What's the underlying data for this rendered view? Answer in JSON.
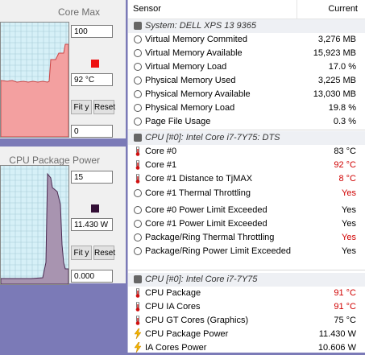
{
  "panel1": {
    "title": "Core Max",
    "max_value": "100",
    "current_value": "92 °C",
    "min_value": "0",
    "color": "#ee1111",
    "fit_label": "Fit y",
    "reset_label": "Reset"
  },
  "panel2": {
    "title": "CPU Package Power",
    "max_value": "15",
    "current_value": "11.430 W",
    "min_value": "0.000",
    "color": "#330f36",
    "fit_label": "Fit y",
    "reset_label": "Reset"
  },
  "header": {
    "sensor": "Sensor",
    "current": "Current"
  },
  "rows": [
    {
      "type": "group",
      "icon": "disk-icon",
      "label": "System: DELL XPS 13 9365",
      "value": ""
    },
    {
      "type": "item",
      "icon": "clock-icon",
      "label": "Virtual Memory Commited",
      "value": "3,276 MB",
      "red": false
    },
    {
      "type": "item",
      "icon": "clock-icon",
      "label": "Virtual Memory Available",
      "value": "15,923 MB",
      "red": false
    },
    {
      "type": "item",
      "icon": "clock-icon",
      "label": "Virtual Memory Load",
      "value": "17.0 %",
      "red": false
    },
    {
      "type": "item",
      "icon": "clock-icon",
      "label": "Physical Memory Used",
      "value": "3,225 MB",
      "red": false
    },
    {
      "type": "item",
      "icon": "clock-icon",
      "label": "Physical Memory Available",
      "value": "13,030 MB",
      "red": false
    },
    {
      "type": "item",
      "icon": "clock-icon",
      "label": "Physical Memory Load",
      "value": "19.8 %",
      "red": false
    },
    {
      "type": "item",
      "icon": "clock-icon",
      "label": "Page File Usage",
      "value": "0.3 %",
      "red": false
    },
    {
      "type": "group",
      "icon": "disk-icon",
      "label": "CPU [#0]: Intel Core i7-7Y75: DTS",
      "value": ""
    },
    {
      "type": "item",
      "icon": "thermometer-icon",
      "label": "Core #0",
      "value": "83 °C",
      "red": false
    },
    {
      "type": "item",
      "icon": "thermometer-icon",
      "label": "Core #1",
      "value": "92 °C",
      "red": true
    },
    {
      "type": "item",
      "icon": "thermometer-icon",
      "label": "Core #1 Distance to TjMAX",
      "value": "8 °C",
      "red": true
    },
    {
      "type": "item",
      "icon": "clock-icon",
      "label": "Core #1 Thermal Throttling",
      "value": "Yes",
      "red": true
    },
    {
      "type": "item",
      "icon": "clock-icon",
      "label": "Core #0 Power Limit Exceeded",
      "value": "Yes",
      "red": false
    },
    {
      "type": "item",
      "icon": "clock-icon",
      "label": "Core #1 Power Limit Exceeded",
      "value": "Yes",
      "red": false
    },
    {
      "type": "item",
      "icon": "clock-icon",
      "label": "Package/Ring Thermal Throttling",
      "value": "Yes",
      "red": true
    },
    {
      "type": "item",
      "icon": "clock-icon",
      "label": "Package/Ring Power Limit Exceeded",
      "value": "Yes",
      "red": false
    },
    {
      "type": "group",
      "icon": "disk-icon",
      "label": "CPU [#0]: Intel Core i7-7Y75",
      "value": ""
    },
    {
      "type": "item",
      "icon": "thermometer-icon",
      "label": "CPU Package",
      "value": "91 °C",
      "red": true
    },
    {
      "type": "item",
      "icon": "thermometer-icon",
      "label": "CPU IA Cores",
      "value": "91 °C",
      "red": true
    },
    {
      "type": "item",
      "icon": "thermometer-icon",
      "label": "CPU GT Cores (Graphics)",
      "value": "75 °C",
      "red": false
    },
    {
      "type": "item",
      "icon": "lightning-icon",
      "label": "CPU Package Power",
      "value": "11.430 W",
      "red": false
    },
    {
      "type": "item",
      "icon": "lightning-icon",
      "label": "IA Cores Power",
      "value": "10.606 W",
      "red": false
    }
  ]
}
